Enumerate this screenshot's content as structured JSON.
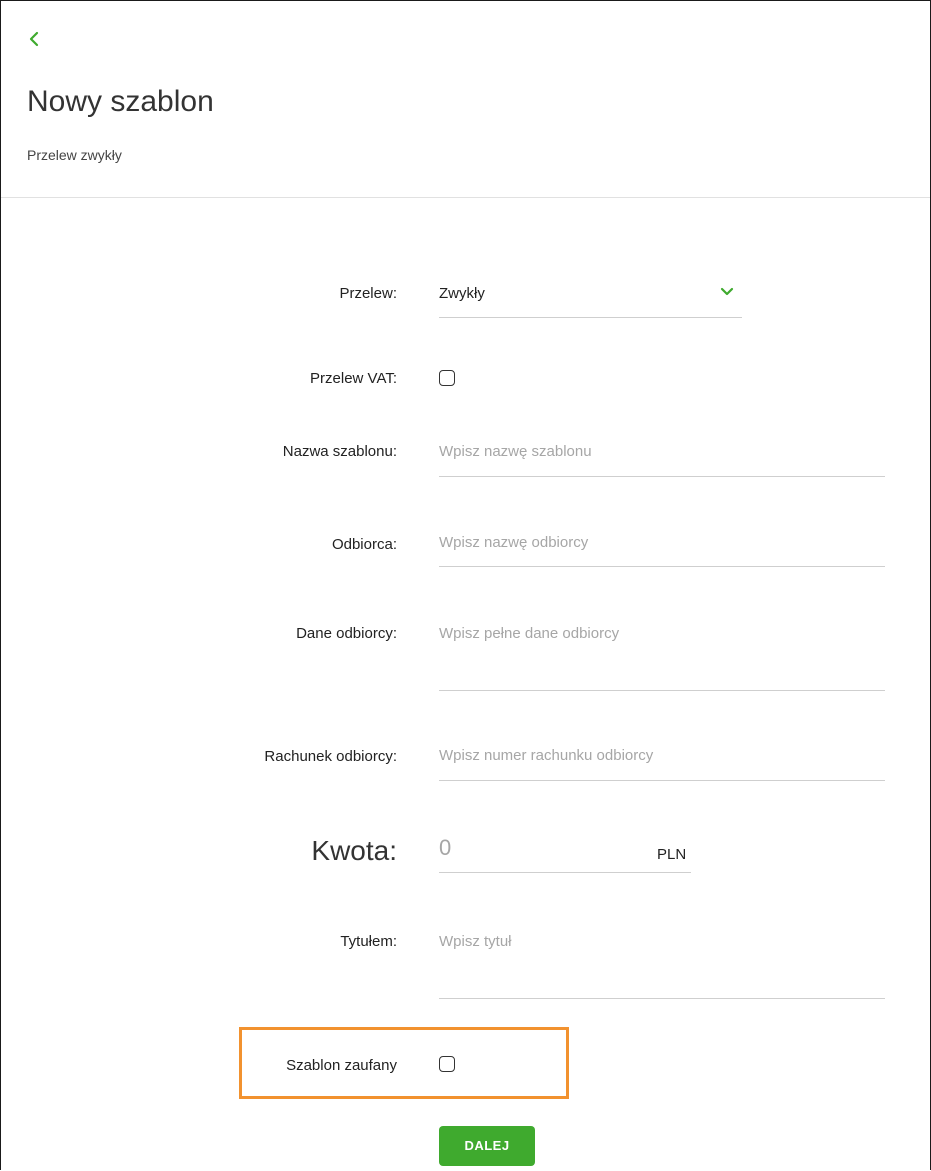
{
  "header": {
    "title": "Nowy szablon",
    "subtitle": "Przelew zwykły"
  },
  "form": {
    "transfer_type": {
      "label": "Przelew:",
      "value": "Zwykły"
    },
    "vat": {
      "label": "Przelew VAT:",
      "checked": false
    },
    "template_name": {
      "label": "Nazwa szablonu:",
      "placeholder": "Wpisz nazwę szablonu"
    },
    "recipient": {
      "label": "Odbiorca:",
      "placeholder": "Wpisz nazwę odbiorcy"
    },
    "recipient_details": {
      "label": "Dane odbiorcy:",
      "placeholder": "Wpisz pełne dane odbiorcy"
    },
    "recipient_account": {
      "label": "Rachunek odbiorcy:",
      "placeholder": "Wpisz numer rachunku odbiorcy"
    },
    "amount": {
      "label": "Kwota:",
      "placeholder": "0",
      "currency": "PLN"
    },
    "title": {
      "label": "Tytułem:",
      "placeholder": "Wpisz tytuł"
    },
    "trusted": {
      "label": "Szablon zaufany",
      "checked": false
    }
  },
  "actions": {
    "next_label": "DALEJ"
  },
  "colors": {
    "accent_green": "#3faa2e",
    "highlight_orange": "#f2922f"
  }
}
